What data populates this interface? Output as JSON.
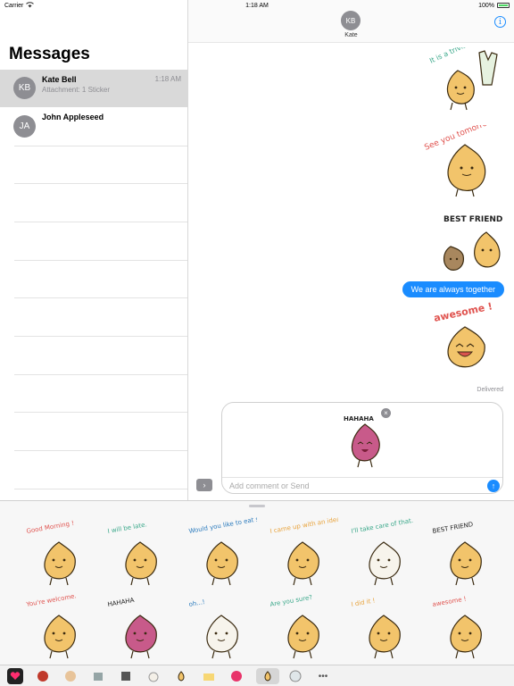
{
  "status_bar": {
    "carrier": "Carrier",
    "time": "1:18 AM",
    "battery": "100%"
  },
  "sidebar": {
    "title": "Messages",
    "conversations": [
      {
        "initials": "KB",
        "name": "Kate Bell",
        "preview": "Attachment: 1 Sticker",
        "time": "1:18 AM",
        "selected": true
      },
      {
        "initials": "JA",
        "name": "John Appleseed",
        "preview": "",
        "time": "",
        "selected": false
      }
    ]
  },
  "chat": {
    "contact_initials": "KB",
    "contact_name": "Kate",
    "bubble_text": "We are always together",
    "delivered_label": "Delivered",
    "compose_placeholder": "Add comment or Send",
    "stickers": [
      {
        "caption": "It is a trivial matter",
        "color": "#3aa88a"
      },
      {
        "caption": "See you tomorrow.",
        "color": "#e0534f"
      },
      {
        "caption": "BEST FRIEND",
        "color": "#222222"
      },
      {
        "caption": "awesome !",
        "color": "#e0534f"
      }
    ],
    "pending_sticker_caption": "HAHAHA"
  },
  "drawer": {
    "row1": [
      {
        "caption": "Good Morning !",
        "color": "#e0534f"
      },
      {
        "caption": "I will be late.",
        "color": "#3aa88a"
      },
      {
        "caption": "Would you like to eat something...?",
        "color": "#2b7bbd"
      },
      {
        "caption": "I came up with an idea!!",
        "color": "#e8a33c"
      },
      {
        "caption": "I'll take care of that.",
        "color": "#3aa88a"
      },
      {
        "caption": "BEST FRIEND",
        "color": "#222222"
      }
    ],
    "row2": [
      {
        "caption": "You're welcome.",
        "color": "#e0534f"
      },
      {
        "caption": "HAHAHA",
        "color": "#222222"
      },
      {
        "caption": "oh...!",
        "color": "#2b7bbd"
      },
      {
        "caption": "Are you sure?",
        "color": "#3aa88a"
      },
      {
        "caption": "I did it !",
        "color": "#e8a33c"
      },
      {
        "caption": "awesome !",
        "color": "#e0534f"
      }
    ]
  },
  "dock": {
    "more_label": "•••"
  },
  "colors": {
    "accent": "#1a8cff",
    "onion": "#f2c46b",
    "onion_outline": "#3a2a10",
    "pink_onion": "#c85a8a"
  }
}
